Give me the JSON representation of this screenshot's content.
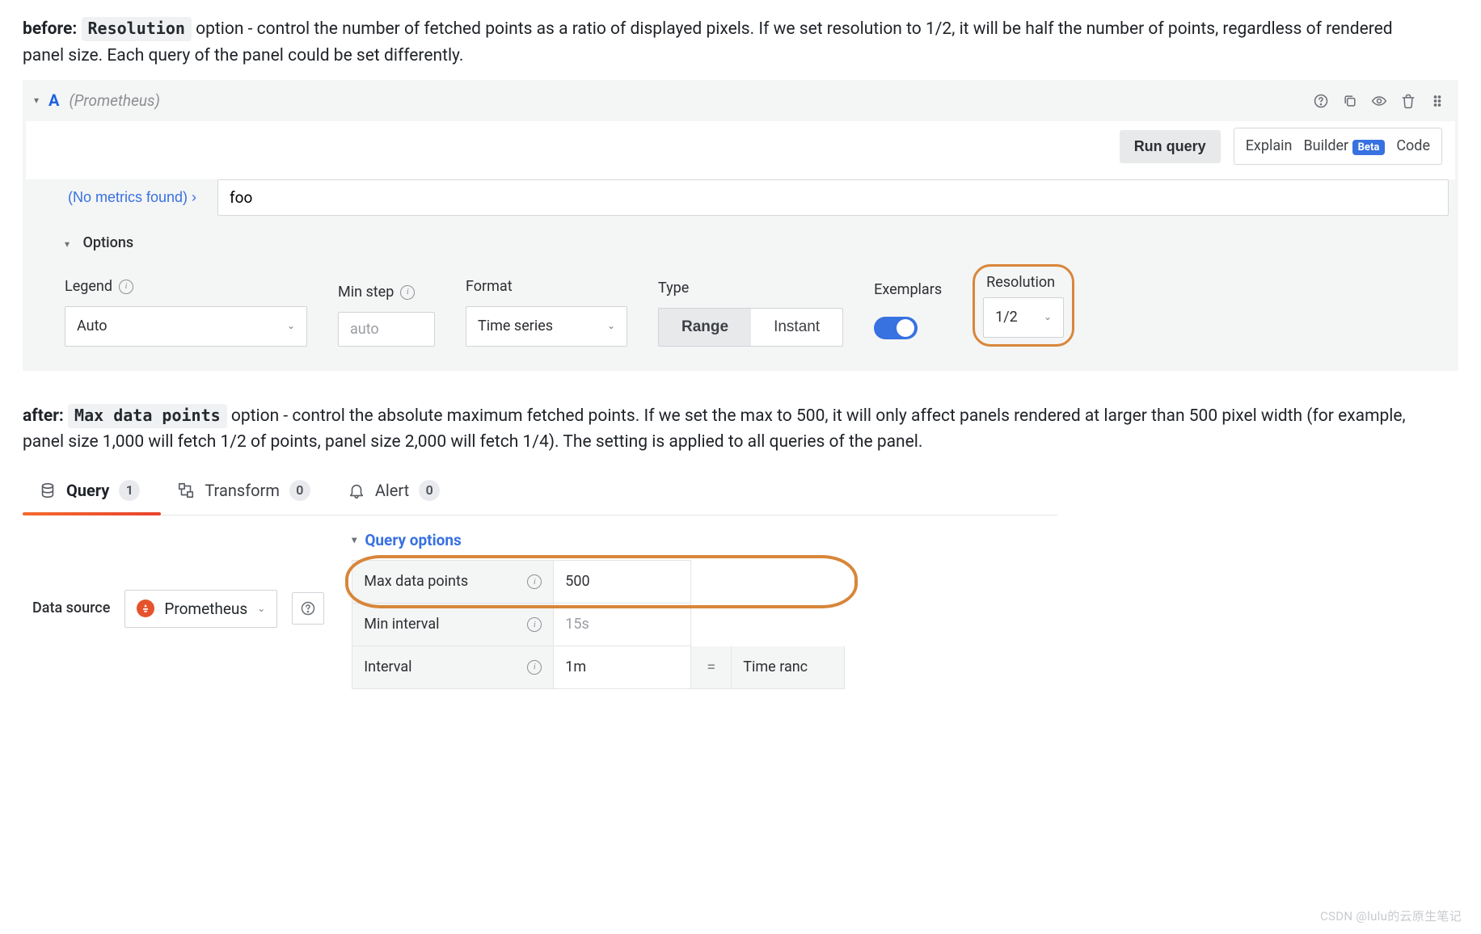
{
  "before": {
    "label": "before:",
    "code": "Resolution",
    "rest": " option - control the number of fetched points as a ratio of displayed pixels. If we set resolution to 1/2, it will be half the number of points, regardless of rendered panel size. Each query of the panel could be set differently."
  },
  "after": {
    "label": "after:",
    "code": "Max data points",
    "rest": " option - control the absolute maximum fetched points. If we set the max to 500, it will only affect panels rendered at larger than 500 pixel width (for example, panel size 1,000 will fetch 1/2 of points, panel size 2,000 will fetch 1/4). The setting is applied to all queries of the panel."
  },
  "query_header": {
    "letter": "A",
    "datasource": "(Prometheus)"
  },
  "row2": {
    "run": "Run query",
    "explain": "Explain",
    "builder": "Builder",
    "beta": "Beta",
    "code": "Code"
  },
  "metrics": {
    "no_metrics": "(No metrics found)  ›",
    "query_value": "foo"
  },
  "options": {
    "header": "Options",
    "legend": {
      "label": "Legend",
      "value": "Auto"
    },
    "minstep": {
      "label": "Min step",
      "placeholder": "auto"
    },
    "format": {
      "label": "Format",
      "value": "Time series"
    },
    "type": {
      "label": "Type",
      "range": "Range",
      "instant": "Instant"
    },
    "exemplars": {
      "label": "Exemplars"
    },
    "resolution": {
      "label": "Resolution",
      "value": "1/2"
    }
  },
  "tabs2": {
    "query": {
      "label": "Query",
      "count": "1"
    },
    "transform": {
      "label": "Transform",
      "count": "0"
    },
    "alert": {
      "label": "Alert",
      "count": "0"
    }
  },
  "ds": {
    "label": "Data source",
    "value": "Prometheus"
  },
  "qopts": {
    "header": "Query options",
    "rows": {
      "max_dp": {
        "label": "Max data points",
        "value": "500"
      },
      "min_int": {
        "label": "Min interval",
        "placeholder": "15s"
      },
      "interval": {
        "label": "Interval",
        "value": "1m",
        "eq": "=",
        "extra": "Time ranc"
      }
    }
  },
  "watermark": "CSDN @lulu的云原生笔记"
}
